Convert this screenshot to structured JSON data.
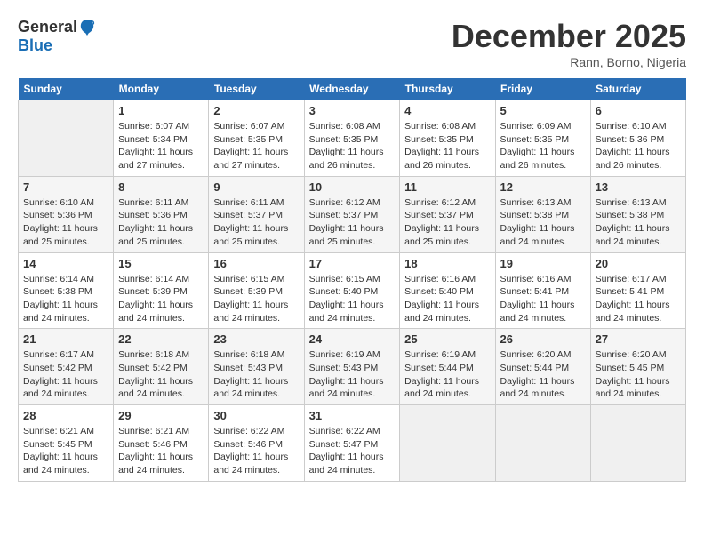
{
  "header": {
    "logo_general": "General",
    "logo_blue": "Blue",
    "month_title": "December 2025",
    "location": "Rann, Borno, Nigeria"
  },
  "calendar": {
    "headers": [
      "Sunday",
      "Monday",
      "Tuesday",
      "Wednesday",
      "Thursday",
      "Friday",
      "Saturday"
    ],
    "weeks": [
      [
        {
          "day": "",
          "sunrise": "",
          "sunset": "",
          "daylight": "",
          "empty": true
        },
        {
          "day": "1",
          "sunrise": "Sunrise: 6:07 AM",
          "sunset": "Sunset: 5:34 PM",
          "daylight": "Daylight: 11 hours and 27 minutes."
        },
        {
          "day": "2",
          "sunrise": "Sunrise: 6:07 AM",
          "sunset": "Sunset: 5:35 PM",
          "daylight": "Daylight: 11 hours and 27 minutes."
        },
        {
          "day": "3",
          "sunrise": "Sunrise: 6:08 AM",
          "sunset": "Sunset: 5:35 PM",
          "daylight": "Daylight: 11 hours and 26 minutes."
        },
        {
          "day": "4",
          "sunrise": "Sunrise: 6:08 AM",
          "sunset": "Sunset: 5:35 PM",
          "daylight": "Daylight: 11 hours and 26 minutes."
        },
        {
          "day": "5",
          "sunrise": "Sunrise: 6:09 AM",
          "sunset": "Sunset: 5:35 PM",
          "daylight": "Daylight: 11 hours and 26 minutes."
        },
        {
          "day": "6",
          "sunrise": "Sunrise: 6:10 AM",
          "sunset": "Sunset: 5:36 PM",
          "daylight": "Daylight: 11 hours and 26 minutes."
        }
      ],
      [
        {
          "day": "7",
          "sunrise": "Sunrise: 6:10 AM",
          "sunset": "Sunset: 5:36 PM",
          "daylight": "Daylight: 11 hours and 25 minutes."
        },
        {
          "day": "8",
          "sunrise": "Sunrise: 6:11 AM",
          "sunset": "Sunset: 5:36 PM",
          "daylight": "Daylight: 11 hours and 25 minutes."
        },
        {
          "day": "9",
          "sunrise": "Sunrise: 6:11 AM",
          "sunset": "Sunset: 5:37 PM",
          "daylight": "Daylight: 11 hours and 25 minutes."
        },
        {
          "day": "10",
          "sunrise": "Sunrise: 6:12 AM",
          "sunset": "Sunset: 5:37 PM",
          "daylight": "Daylight: 11 hours and 25 minutes."
        },
        {
          "day": "11",
          "sunrise": "Sunrise: 6:12 AM",
          "sunset": "Sunset: 5:37 PM",
          "daylight": "Daylight: 11 hours and 25 minutes."
        },
        {
          "day": "12",
          "sunrise": "Sunrise: 6:13 AM",
          "sunset": "Sunset: 5:38 PM",
          "daylight": "Daylight: 11 hours and 24 minutes."
        },
        {
          "day": "13",
          "sunrise": "Sunrise: 6:13 AM",
          "sunset": "Sunset: 5:38 PM",
          "daylight": "Daylight: 11 hours and 24 minutes."
        }
      ],
      [
        {
          "day": "14",
          "sunrise": "Sunrise: 6:14 AM",
          "sunset": "Sunset: 5:38 PM",
          "daylight": "Daylight: 11 hours and 24 minutes."
        },
        {
          "day": "15",
          "sunrise": "Sunrise: 6:14 AM",
          "sunset": "Sunset: 5:39 PM",
          "daylight": "Daylight: 11 hours and 24 minutes."
        },
        {
          "day": "16",
          "sunrise": "Sunrise: 6:15 AM",
          "sunset": "Sunset: 5:39 PM",
          "daylight": "Daylight: 11 hours and 24 minutes."
        },
        {
          "day": "17",
          "sunrise": "Sunrise: 6:15 AM",
          "sunset": "Sunset: 5:40 PM",
          "daylight": "Daylight: 11 hours and 24 minutes."
        },
        {
          "day": "18",
          "sunrise": "Sunrise: 6:16 AM",
          "sunset": "Sunset: 5:40 PM",
          "daylight": "Daylight: 11 hours and 24 minutes."
        },
        {
          "day": "19",
          "sunrise": "Sunrise: 6:16 AM",
          "sunset": "Sunset: 5:41 PM",
          "daylight": "Daylight: 11 hours and 24 minutes."
        },
        {
          "day": "20",
          "sunrise": "Sunrise: 6:17 AM",
          "sunset": "Sunset: 5:41 PM",
          "daylight": "Daylight: 11 hours and 24 minutes."
        }
      ],
      [
        {
          "day": "21",
          "sunrise": "Sunrise: 6:17 AM",
          "sunset": "Sunset: 5:42 PM",
          "daylight": "Daylight: 11 hours and 24 minutes."
        },
        {
          "day": "22",
          "sunrise": "Sunrise: 6:18 AM",
          "sunset": "Sunset: 5:42 PM",
          "daylight": "Daylight: 11 hours and 24 minutes."
        },
        {
          "day": "23",
          "sunrise": "Sunrise: 6:18 AM",
          "sunset": "Sunset: 5:43 PM",
          "daylight": "Daylight: 11 hours and 24 minutes."
        },
        {
          "day": "24",
          "sunrise": "Sunrise: 6:19 AM",
          "sunset": "Sunset: 5:43 PM",
          "daylight": "Daylight: 11 hours and 24 minutes."
        },
        {
          "day": "25",
          "sunrise": "Sunrise: 6:19 AM",
          "sunset": "Sunset: 5:44 PM",
          "daylight": "Daylight: 11 hours and 24 minutes."
        },
        {
          "day": "26",
          "sunrise": "Sunrise: 6:20 AM",
          "sunset": "Sunset: 5:44 PM",
          "daylight": "Daylight: 11 hours and 24 minutes."
        },
        {
          "day": "27",
          "sunrise": "Sunrise: 6:20 AM",
          "sunset": "Sunset: 5:45 PM",
          "daylight": "Daylight: 11 hours and 24 minutes."
        }
      ],
      [
        {
          "day": "28",
          "sunrise": "Sunrise: 6:21 AM",
          "sunset": "Sunset: 5:45 PM",
          "daylight": "Daylight: 11 hours and 24 minutes."
        },
        {
          "day": "29",
          "sunrise": "Sunrise: 6:21 AM",
          "sunset": "Sunset: 5:46 PM",
          "daylight": "Daylight: 11 hours and 24 minutes."
        },
        {
          "day": "30",
          "sunrise": "Sunrise: 6:22 AM",
          "sunset": "Sunset: 5:46 PM",
          "daylight": "Daylight: 11 hours and 24 minutes."
        },
        {
          "day": "31",
          "sunrise": "Sunrise: 6:22 AM",
          "sunset": "Sunset: 5:47 PM",
          "daylight": "Daylight: 11 hours and 24 minutes."
        },
        {
          "day": "",
          "sunrise": "",
          "sunset": "",
          "daylight": "",
          "empty": true
        },
        {
          "day": "",
          "sunrise": "",
          "sunset": "",
          "daylight": "",
          "empty": true
        },
        {
          "day": "",
          "sunrise": "",
          "sunset": "",
          "daylight": "",
          "empty": true
        }
      ]
    ]
  }
}
